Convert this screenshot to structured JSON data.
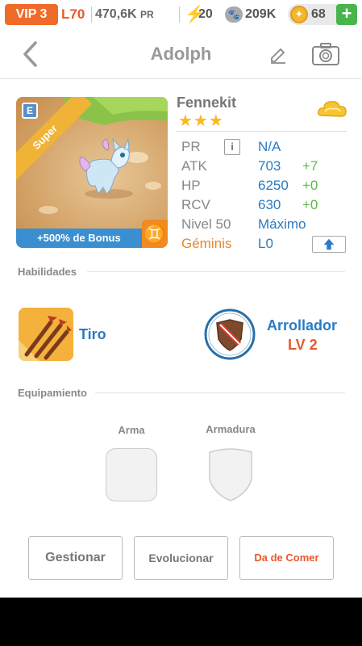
{
  "topbar": {
    "vip": "VIP 3",
    "level": "L70",
    "pr_value": "470,6K",
    "pr_unit": "PR",
    "energy": "20",
    "coins": "209K",
    "gems": "68",
    "add_label": "+",
    "colors": {
      "vip": "#f06a2a",
      "add": "#47b54b",
      "gem": "#f2b631"
    }
  },
  "header": {
    "title": "Adolph",
    "icons": [
      "back-chevron-icon",
      "pencil-icon",
      "camera-icon"
    ]
  },
  "monster": {
    "name": "Fennekit",
    "stars": "★★★",
    "rarity_ribbon": "Super",
    "badge": "E",
    "bonus": "+500% de Bonus",
    "zodiac_symbol": "♊",
    "element_icon": "light-cloud-icon",
    "stats": {
      "pr": {
        "label": "PR",
        "value": "N/A"
      },
      "atk": {
        "label": "ATK",
        "value": "703",
        "plus": "+7"
      },
      "hp": {
        "label": "HP",
        "value": "6250",
        "plus": "+0"
      },
      "rcv": {
        "label": "RCV",
        "value": "630",
        "plus": "+0"
      },
      "level": {
        "label": "Nivel 50",
        "value": "Máximo"
      },
      "gemini": {
        "label": "Géminis",
        "value": "L0"
      }
    },
    "info_icon_label": "i"
  },
  "abilities": {
    "section_title": "Habilidades",
    "active": {
      "name": "Tiro",
      "icon": "arrows-icon"
    },
    "leader": {
      "name": "Arrollador",
      "level": "LV 2",
      "icon": "shield-icon"
    }
  },
  "equipment": {
    "section_title": "Equipamiento",
    "weapon_label": "Arma",
    "armor_label": "Armadura"
  },
  "actions": {
    "manage": "Gestionar",
    "evolve": "Evolucionar",
    "feed": "Da de Comer",
    "feed_color": "#e8572a"
  }
}
